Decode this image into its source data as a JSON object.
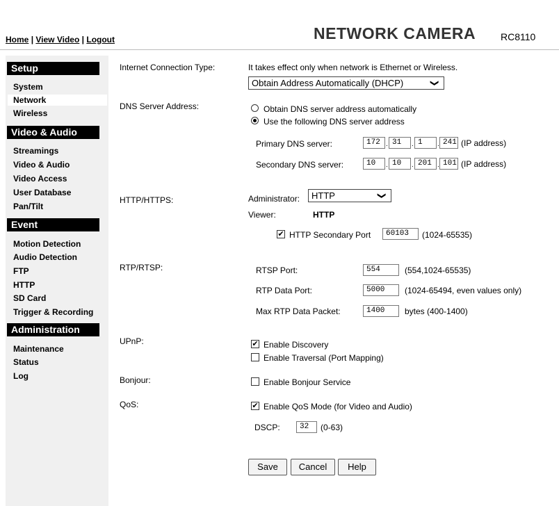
{
  "header": {
    "links": [
      "Home",
      "View Video",
      "Logout"
    ],
    "separator": "|",
    "title": "NETWORK CAMERA",
    "model": "RC8110"
  },
  "sidebar": {
    "sections": [
      {
        "title": "Setup",
        "items": [
          "System",
          "Network",
          "Wireless"
        ]
      },
      {
        "title": "Video & Audio",
        "items": [
          "Streamings",
          "Video & Audio",
          "Video Access",
          "User Database",
          "Pan/Tilt"
        ]
      },
      {
        "title": "Event",
        "items": [
          "Motion Detection",
          "Audio Detection",
          "FTP",
          "HTTP",
          "SD Card",
          "Trigger & Recording"
        ]
      },
      {
        "title": "Administration",
        "items": [
          "Maintenance",
          "Status",
          "Log"
        ]
      }
    ],
    "active_item": "Network"
  },
  "internet": {
    "label": "Internet Connection Type:",
    "note": "It takes effect only when network is Ethernet or Wireless.",
    "value": "Obtain Address Automatically (DHCP)"
  },
  "dns": {
    "label": "DNS Server Address:",
    "option_auto": "Obtain DNS server address automatically",
    "option_manual": "Use the following DNS server address",
    "selected": "manual",
    "primary_label": "Primary DNS server:",
    "primary": [
      "172",
      "31",
      "1",
      "241"
    ],
    "secondary_label": "Secondary DNS server:",
    "secondary": [
      "10",
      "10",
      "201",
      "101"
    ],
    "ip_suffix": "(IP address)",
    "dot": "."
  },
  "http": {
    "label": "HTTP/HTTPS:",
    "admin_label": "Administrator:",
    "admin_value": "HTTP",
    "viewer_label": "Viewer:",
    "viewer_value": "HTTP",
    "secondary_checked": true,
    "secondary_label": "HTTP Secondary Port",
    "secondary_port": "60103",
    "secondary_range": "(1024-65535)"
  },
  "rtp": {
    "label": "RTP/RTSP:",
    "rtsp_label": "RTSP Port:",
    "rtsp_value": "554",
    "rtsp_range": "(554,1024-65535)",
    "data_label": "RTP Data Port:",
    "data_value": "5000",
    "data_range": "(1024-65494, even values only)",
    "packet_label": "Max RTP Data Packet:",
    "packet_value": "1400",
    "packet_range": "bytes (400-1400)"
  },
  "upnp": {
    "label": "UPnP:",
    "discovery_label": "Enable Discovery",
    "discovery_checked": true,
    "traversal_label": "Enable Traversal (Port Mapping)",
    "traversal_checked": false
  },
  "bonjour": {
    "label": "Bonjour:",
    "service_label": "Enable Bonjour Service",
    "checked": false
  },
  "qos": {
    "label": "QoS:",
    "mode_label": "Enable QoS Mode (for Video and Audio)",
    "checked": true,
    "dscp_label": "DSCP:",
    "dscp_value": "32",
    "dscp_range": "(0-63)"
  },
  "buttons": {
    "save": "Save",
    "cancel": "Cancel",
    "help": "Help"
  },
  "glyphs": {
    "check": "✔",
    "chevron": "❯"
  }
}
